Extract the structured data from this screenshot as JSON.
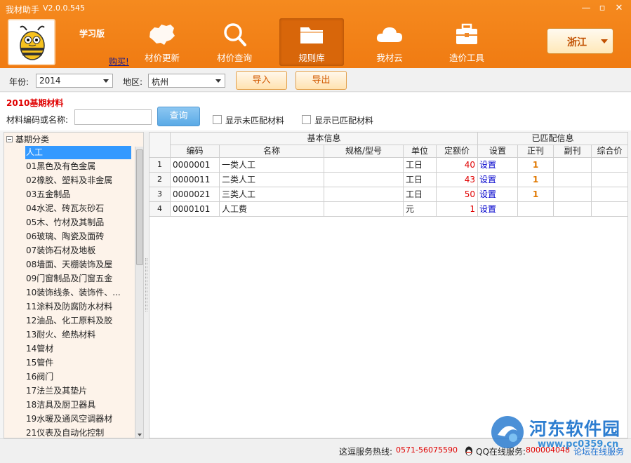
{
  "window": {
    "title": "我材助手",
    "version": "V2.0.0.545",
    "controls": [
      "—",
      "▫",
      "✕"
    ]
  },
  "header": {
    "edition": "学习版",
    "buy_link": "购买!",
    "nav": [
      {
        "label": "材价更新",
        "icon": "china-map-icon"
      },
      {
        "label": "材价查询",
        "icon": "magnifier-icon"
      },
      {
        "label": "规则库",
        "icon": "folder-icon",
        "active": true
      },
      {
        "label": "我材云",
        "icon": "cloud-icon"
      },
      {
        "label": "造价工具",
        "icon": "toolbox-icon"
      }
    ],
    "province": "浙江"
  },
  "toolbar": {
    "year_label": "年份:",
    "year_value": "2014",
    "region_label": "地区:",
    "region_value": "杭州",
    "import_label": "导入",
    "export_label": "导出"
  },
  "search": {
    "section_title": "2010基期材料",
    "code_label": "材料编码或名称:",
    "input_value": "",
    "query_label": "查询",
    "show_unmatched": "显示未匹配材料",
    "show_matched": "显示已匹配材料"
  },
  "tree": {
    "root": "基期分类",
    "items": [
      "人工",
      "01黑色及有色金属",
      "02橡胶、塑料及非金属",
      "03五金制品",
      "04水泥、砖瓦灰砂石",
      "05木、竹材及其制品",
      "06玻璃、陶瓷及面砖",
      "07装饰石材及地板",
      "08墙面、天棚装饰及屋",
      "09门窗制品及门窗五金",
      "10装饰线条、装饰件、...",
      "11涂料及防腐防水材料",
      "12油品、化工原料及胶",
      "13耐火、绝热材料",
      "14管材",
      "15管件",
      "16阀门",
      "17法兰及其垫片",
      "18洁具及厨卫器具",
      "19水暖及通风空调器材",
      "21仪表及自动化控制"
    ]
  },
  "grid": {
    "group_basic": "基本信息",
    "group_matched": "已匹配信息",
    "columns": [
      "编码",
      "名称",
      "规格/型号",
      "单位",
      "定额价",
      "设置",
      "正刊",
      "副刊",
      "综合价"
    ],
    "rows": [
      {
        "no": "1",
        "code": "0000001",
        "name": "一类人工",
        "spec": "",
        "unit": "工日",
        "price": "40",
        "setting": "设置",
        "main": "1",
        "sub": "",
        "total": ""
      },
      {
        "no": "2",
        "code": "0000011",
        "name": "二类人工",
        "spec": "",
        "unit": "工日",
        "price": "43",
        "setting": "设置",
        "main": "1",
        "sub": "",
        "total": ""
      },
      {
        "no": "3",
        "code": "0000021",
        "name": "三类人工",
        "spec": "",
        "unit": "工日",
        "price": "50",
        "setting": "设置",
        "main": "1",
        "sub": "",
        "total": ""
      },
      {
        "no": "4",
        "code": "0000101",
        "name": "人工费",
        "spec": "",
        "unit": "元",
        "price": "1",
        "setting": "设置",
        "main": "",
        "sub": "",
        "total": ""
      }
    ]
  },
  "status": {
    "hotline_label": "这逗服务热线:",
    "hotline": "0571-56075590",
    "qq_label": "QQ在线服务:",
    "qq_number": "800004048",
    "online_link": "论坛在线服务"
  },
  "watermark": {
    "text": "河东软件园",
    "url": "www.pc0359.cn"
  },
  "colors": {
    "header_orange": "#f07b12",
    "accent_red": "#e00000",
    "link_blue": "#0000cc",
    "selected_blue": "#3399ff"
  }
}
